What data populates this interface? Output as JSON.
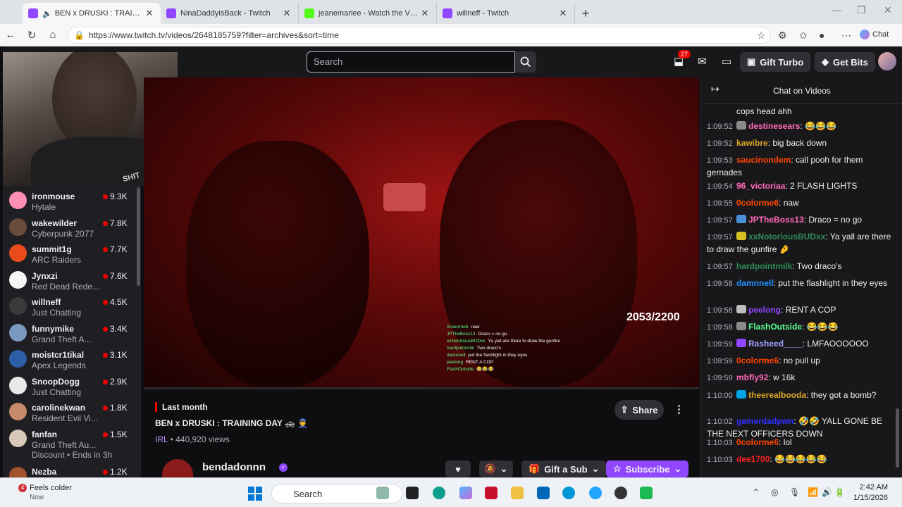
{
  "tabs": [
    {
      "title": "BEN x DRUSKI : TRAINING DAY",
      "color": "#9146ff",
      "active": true
    },
    {
      "title": "NinaDaddyisBack - Twitch",
      "color": "#9146ff",
      "active": false
    },
    {
      "title": "jeanemariee - Watch the VOD on K",
      "color": "#53fc18",
      "active": false
    },
    {
      "title": "willneff - Twitch",
      "color": "#9146ff",
      "active": false
    }
  ],
  "address": {
    "url": "https://www.twitch.tv/videos/2648185759?filter=archives&sort=time",
    "chat_label": "Chat"
  },
  "topnav": {
    "search_placeholder": "Search",
    "notif_count": "27",
    "gift_turbo": "Gift Turbo",
    "get_bits": "Get Bits"
  },
  "webcam": {
    "shirt_text": "SHIT"
  },
  "sidebar": {
    "channels": [
      {
        "name": "ironmouse",
        "game": "Hytale",
        "viewers": "9.3K",
        "color": "#ff8fb5"
      },
      {
        "name": "wakewilder",
        "game": "Cyberpunk 2077",
        "viewers": "7.8K",
        "color": "#6b4b3a"
      },
      {
        "name": "summit1g",
        "game": "ARC Raiders",
        "viewers": "7.7K",
        "color": "#e94b1b"
      },
      {
        "name": "Jynxzi",
        "game": "Red Dead Rede...",
        "viewers": "7.6K",
        "color": "#f5f5f5"
      },
      {
        "name": "willneff",
        "game": "Just Chatting",
        "viewers": "4.5K",
        "color": "#3a3a3a"
      },
      {
        "name": "funnymike",
        "game": "Grand Theft A...",
        "viewers": "3.4K",
        "color": "#7a9ac0"
      },
      {
        "name": "moistcr1tikal",
        "game": "Apex Legends",
        "viewers": "3.1K",
        "color": "#2c5fa8"
      },
      {
        "name": "SnoopDogg",
        "game": "Just Chatting",
        "viewers": "2.9K",
        "color": "#e8e8e8"
      },
      {
        "name": "carolinekwan",
        "game": "Resident Evil Vi...",
        "viewers": "1.8K",
        "color": "#c48a6a"
      },
      {
        "name": "fanfan",
        "game": "Grand Theft Au...",
        "viewers": "1.5K",
        "color": "#d8c8b8",
        "extra": "Discount • Ends in 3h"
      },
      {
        "name": "Nezba",
        "game": "",
        "viewers": "1.2K",
        "color": "#a0522d"
      }
    ]
  },
  "video": {
    "counter": "2053/2200",
    "overlay_chat": [
      {
        "user": "0colorme6",
        "msg": "naw"
      },
      {
        "user": "JPTheBoss13",
        "msg": "Draco = no go"
      },
      {
        "user": "xxNotoriousBUDxx",
        "msg": "Ya yall are there to draw the gunfire"
      },
      {
        "user": "hardpointmilk",
        "msg": "Two draco's"
      },
      {
        "user": "damnnell",
        "msg": "put the flashlight in they eyes"
      },
      {
        "user": "peelong",
        "msg": "RENT A COP"
      },
      {
        "user": "FlashOutside",
        "msg": "😂😂😂"
      }
    ]
  },
  "info": {
    "last_month": "Last month",
    "title": "BEN x DRUSKI : TRAINING DAY 🚓 👮",
    "category": "IRL",
    "views": "440,920 views",
    "share": "Share",
    "channel": "bendadonnn",
    "gift_sub": "Gift a Sub",
    "subscribe": "Subscribe"
  },
  "chat": {
    "title": "Chat on Videos",
    "messages": [
      {
        "time": "",
        "user": "",
        "color": "#efeff1",
        "text": "cops head ahh",
        "cont": true
      },
      {
        "time": "1:09:52",
        "user": "destinesears",
        "color": "#ff69b4",
        "text": "😂😂😂",
        "badge": "#8a8a8a"
      },
      {
        "time": "1:09:52",
        "user": "kawibre",
        "color": "#daa520",
        "text": "big back down"
      },
      {
        "time": "1:09:53",
        "user": "saucinondem",
        "color": "#ff4500",
        "text": "call pooh for them gernades"
      },
      {
        "time": "1:09:54",
        "user": "96_victoriaa",
        "color": "#ff69b4",
        "text": "2 FLASH LIGHTS"
      },
      {
        "time": "1:09:55",
        "user": "0colorme6",
        "color": "#ff4500",
        "text": "naw"
      },
      {
        "time": "1:09:57",
        "user": "JPTheBoss13",
        "color": "#ff69b4",
        "text": "Draco = no go",
        "badge": "#4a90d9"
      },
      {
        "time": "1:09:57",
        "user": "xxNotoriousBUDxx",
        "color": "#2e8b57",
        "text": "Ya yall are there to draw the gunfire 🤌",
        "badge": "#d4c020"
      },
      {
        "time": "1:09:57",
        "user": "hardpointmilk",
        "color": "#2e8b57",
        "text": "Two draco's"
      },
      {
        "time": "1:09:58",
        "user": "damnnell",
        "color": "#1e90ff",
        "text": "put the flashlight in they eyes"
      },
      {
        "time": "1:09:58",
        "user": "peelong",
        "color": "#9146ff",
        "text": "RENT A COP",
        "badge": "#bfbfbf"
      },
      {
        "time": "1:09:58",
        "user": "FlashOutside",
        "color": "#58ff8a",
        "text": "😂😂😂",
        "badge": "#8a8a8a"
      },
      {
        "time": "1:09:59",
        "user": "Rasheed____",
        "color": "#a0a0ff",
        "text": "LMFAOOOOOO",
        "badge": "#9146ff"
      },
      {
        "time": "1:09:59",
        "user": "0colorme6",
        "color": "#ff4500",
        "text": "no pull up"
      },
      {
        "time": "1:09:59",
        "user": "mbfly92",
        "color": "#ff69b4",
        "text": "w 16k"
      },
      {
        "time": "1:10:00",
        "user": "theerealbooda",
        "color": "#daa520",
        "text": "they got a bomb?",
        "badge": "#00a2e8"
      },
      {
        "time": "1:10:02",
        "user": "gamerdadpwn",
        "color": "#2f2fff",
        "text": "🤣🤣 YALL GONE BE THE NEXT OFFICERS DOWN"
      },
      {
        "time": "1:10:03",
        "user": "0colorme6",
        "color": "#ff4500",
        "text": "lol"
      },
      {
        "time": "1:10:03",
        "user": "dee1700",
        "color": "#ff2020",
        "text": "😂😂😂😂😂"
      }
    ]
  },
  "taskbar": {
    "weather_badge": "4",
    "weather_title": "Feels colder",
    "weather_sub": "Now",
    "search": "Search",
    "time": "2:42 AM",
    "date": "1/15/2026"
  }
}
